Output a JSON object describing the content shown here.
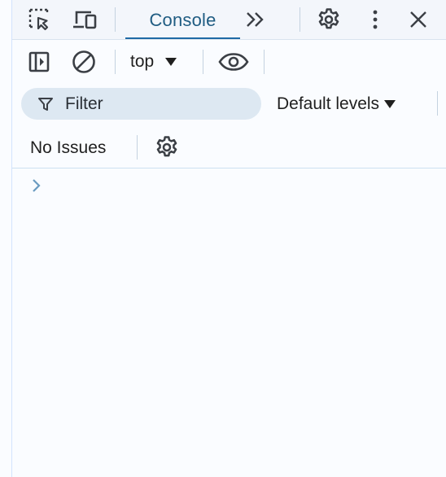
{
  "tabbar": {
    "tabs": [
      {
        "label": "Console",
        "active": true
      }
    ],
    "icons": [
      "select-element-icon",
      "device-toolbar-icon",
      "more-tabs-icon",
      "settings-gear-icon",
      "more-vertical-icon",
      "close-icon"
    ]
  },
  "toolbar": {
    "context_label": "top",
    "filter_placeholder": "Filter",
    "levels_label": "Default levels",
    "issues_label": "No Issues",
    "icons": [
      "sidebar-toggle-icon",
      "clear-console-icon",
      "live-expression-eye-icon",
      "filter-icon",
      "console-settings-gear-icon"
    ]
  },
  "console": {
    "prompt_icon": "prompt-chevron-icon"
  },
  "colors": {
    "active_tab_text": "#1f5c82",
    "active_tab_indicator": "#1f6aa5",
    "filter_background": "#dde8f2",
    "panel_background": "#fafcff"
  }
}
